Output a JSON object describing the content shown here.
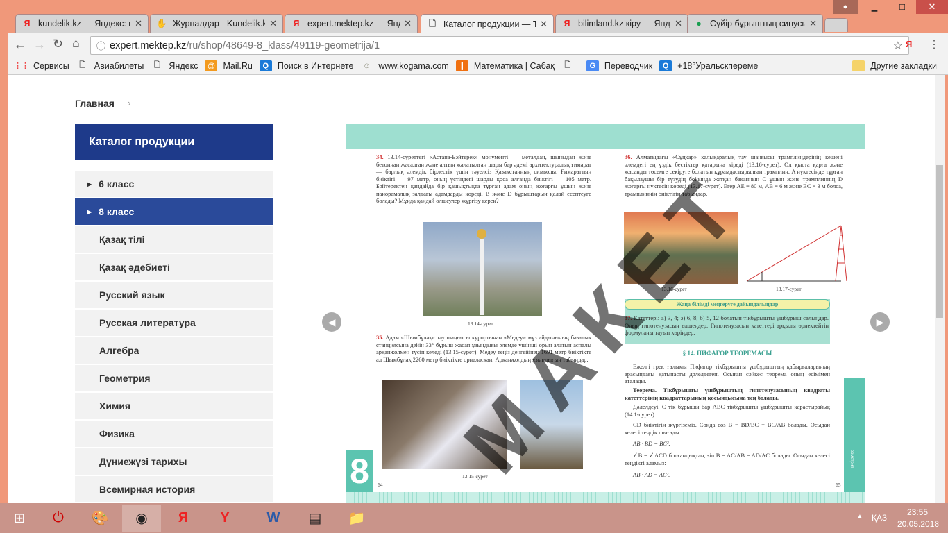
{
  "browser": {
    "tabs": [
      {
        "label": "kundelik.kz — Яндекс: на",
        "icon": "yandex-icon"
      },
      {
        "label": "Журналдар - Kundelik.kz",
        "icon": "kundelik-icon"
      },
      {
        "label": "expert.mektep.kz — Янде",
        "icon": "yandex-icon"
      },
      {
        "label": "Каталог продукции — ТС",
        "icon": "page-icon",
        "active": true
      },
      {
        "label": "bilimland.kz кіру — Янде",
        "icon": "yandex-icon"
      },
      {
        "label": "Сүйір бұрыштың синусы",
        "icon": "classroom-icon"
      }
    ],
    "url_host": "expert.mektep.kz",
    "url_path": "/ru/shop/48649-8_klass/49119-geometrija/1",
    "bookmarks": [
      "Сервисы",
      "Авиабилеты",
      "Яндекс",
      "Mail.Ru",
      "Поиск в Интернете",
      "www.kogama.com",
      "Математика | Сабақ",
      "Переводчик",
      "+18°Уральскпереме"
    ],
    "other_bookmarks": "Другие закладки"
  },
  "page": {
    "breadcrumb": "Главная",
    "catalog_title": "Каталог продукции",
    "sidebar": [
      {
        "label": "6 класс",
        "arrow": true
      },
      {
        "label": "8 класс",
        "arrow": true,
        "selected": true
      },
      {
        "label": "Қазақ тілі"
      },
      {
        "label": "Қазақ әдебиеті"
      },
      {
        "label": "Русский язык"
      },
      {
        "label": "Русская литература"
      },
      {
        "label": "Алгебра"
      },
      {
        "label": "Геометрия"
      },
      {
        "label": "Химия"
      },
      {
        "label": "Физика"
      },
      {
        "label": "Дүниежүзі тарихы"
      },
      {
        "label": "Всемирная история"
      }
    ],
    "book": {
      "watermark": "МАКЕТ",
      "p34_num": "34.",
      "p34": "13.14-суреттегі «Астана-Бәйтерек» монументі — металдан, шыныдан және бетоннан жасалған және алтын жалатылған шары бар әдемі архитектуралық ғимарат — барлық әлемдік бірлестік үшін тәуелсіз Қазақстанның символы. Ғимараттың биіктігі — 97 метр, оның үстіндегі шарды қоса алғанда биіктігі — 105 метр. Бәйтеректен қандайда бір қашықтықта тұрған адам оның жоғарғы ұшын және панорамалық залдағы адамдарды көреді. B және D бұрыштарын қалай есептеуге болады? Мұнда қандай өлшеулер жүргізу керек?",
      "cap1314": "13.14-сурет",
      "p35_num": "35.",
      "p35": "Адам «Шымбұлақ» тау шаңғысы курортынан «Медеу» мұз айдынының базалық станциясына дейін 33° бұрыш жасап ұзындығы әлемде үшінші орын алатын аспалы арқанжолмен түсіп келеді (13.15-сурет). Медеу теңіз деңгейінен 1691 метр биіктікте ал Шымбұлақ 2260 метр биіктікте орналасқан. Арқанжолдың ұзындығын табыңдар.",
      "cap1315": "13.15-сурет",
      "page_left": "64",
      "p36_num": "36.",
      "p36": "Алматыдағы «Сұңқар» халықаралық тау шаңғысы трамплиндерінің кешені әлемдегі ең үздік бестіктер қатарына кіреді (13.16-сурет). Ол қыста қарға және жасанды төсемге секіруге болатын құрамдастырылған трамплин. A нүктесінде тұрған бақылаушы бір түзудің бойында жатқан бақанның C ұшын және трамплиннің D жоғарғы нүктесін көреді (13.17-сурет). Егер AE = 80 м, AB = 6 м және BC = 3 м болса, трамплиннің биіктігін табыңдар.",
      "cap1316": "13.16-сурет",
      "cap1317": "13.17-сурет",
      "banner": "Жаңа білімді меңгеруге дайындалыңдар",
      "p37_num": "37.",
      "p37": "Катеттері: а) 3, 4; ә) 6, 8; б) 5, 12 болатын тікбұрышты үшбұрыш салыңдар. Оның гипотенузасын өлшеңдер. Гипотенузасын катеттері арқылы өрнектейтін формуланы тауып көріңдер.",
      "section": "§ 14. ПИФАГОР ТЕОРЕМАСЫ",
      "intro": "Ежелгі грек ғалымы Пифагор тікбұрышты үшбұрыштың қабырғаларының арасындағы қатынасты дәлелдеген. Осыған сәйкес теорема оның есімімен аталады.",
      "theorem": "Теорема. Тікбұрышты үшбұрыштың гипотенузасының квадраты катеттерінің квадраттарының қосындысына тең болады.",
      "proof": "Дәлелдеуі. C тік бұрышы бар ABC тікбұрышты үшбұрышты қарастырайық (14.1-сурет).",
      "l1": "CD биіктігін жүргіземіз. Сонда cos B = BD/BC = BC/AB болады. Осыдан келесі теңдік шығады:",
      "f1": "AB · BD = BC².",
      "l2": "∠B = ∠ACD болғандықтан, sin B = AC/AB = AD/AC болады. Осыдан келесі теңдікті аламыз:",
      "f2": "AB · AD = AC².",
      "page_right": "65",
      "side_label": "Геометрия",
      "corner_num": "8"
    }
  },
  "taskbar": {
    "lang": "ҚАЗ",
    "time": "23:55",
    "date": "20.05.2018"
  },
  "colors": {
    "titlebar": "#f0987a",
    "catalog_header": "#1e3a8a",
    "selected_item": "#2a4a9a",
    "book_teal": "#9edfd0",
    "taskbar": "#c9948a"
  }
}
